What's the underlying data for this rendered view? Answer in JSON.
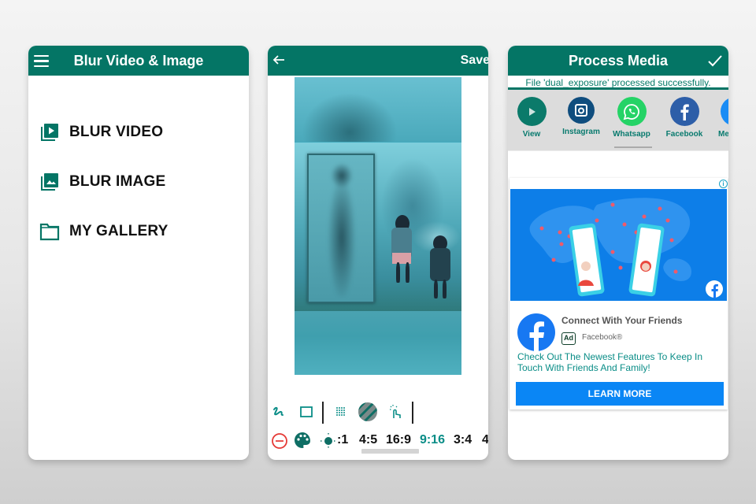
{
  "colors": {
    "primary": "#047565",
    "accent_teal": "#0a8d87",
    "cta_blue": "#0a86f5",
    "facebook_blue": "#1778f2",
    "whatsapp_green": "#25d366",
    "instagram_navy": "#0f4d7e",
    "remove_red": "#e53935"
  },
  "screen1": {
    "title": "Blur Video & Image",
    "menu_icon": "hamburger-icon",
    "menu": [
      {
        "label": "BLUR VIDEO",
        "icon": "video-library-icon"
      },
      {
        "label": "BLUR IMAGE",
        "icon": "photo-library-icon"
      },
      {
        "label": "MY GALLERY",
        "icon": "folder-icon"
      }
    ]
  },
  "screen2": {
    "back_icon": "arrow-left-icon",
    "save_label": "Save",
    "tools": [
      {
        "icon": "freehand-icon"
      },
      {
        "icon": "rectangle-icon"
      },
      {
        "icon": "mosaic-icon"
      },
      {
        "icon": "pattern-icon"
      },
      {
        "icon": "touch-icon"
      }
    ],
    "adjust_tools": [
      {
        "icon": "remove-icon"
      },
      {
        "icon": "palette-icon"
      },
      {
        "icon": "brightness-icon"
      }
    ],
    "ratios": [
      ":1",
      "4:5",
      "16:9",
      "9:16",
      "3:4",
      "4"
    ],
    "active_ratio": "9:16"
  },
  "screen3": {
    "title": "Process Media",
    "confirm_icon": "check-icon",
    "status": "File 'dual_exposure' processed successfully.",
    "share": [
      {
        "label": "View",
        "icon": "play-icon"
      },
      {
        "label": "Instagram",
        "icon": "instagram-icon"
      },
      {
        "label": "Whatsapp",
        "icon": "whatsapp-icon"
      },
      {
        "label": "Facebook",
        "icon": "facebook-icon"
      },
      {
        "label": "Me",
        "icon": "messenger-icon"
      }
    ],
    "ad": {
      "info_glyph": "i",
      "title": "Connect With Your Friends",
      "badge": "Ad",
      "source": "Facebook®",
      "body": "Check Out The Newest Features To Keep In Touch With Friends And Family!",
      "cta": "LEARN MORE"
    }
  }
}
